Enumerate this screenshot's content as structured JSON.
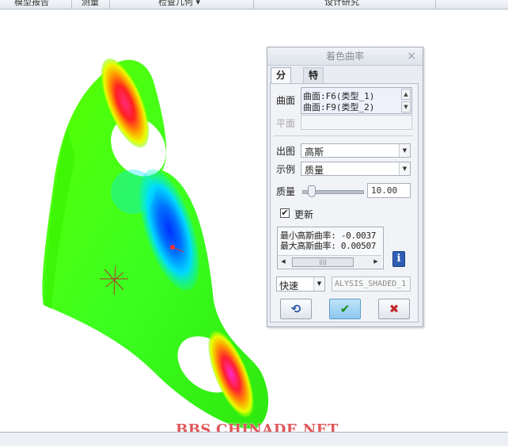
{
  "ribbon": {
    "groups": [
      "模型报告",
      "测量",
      "检查几何 ▾",
      "设计研究"
    ]
  },
  "dialog": {
    "title": "着色曲率",
    "close_glyph": "×",
    "tabs": [
      "分析",
      "特征"
    ],
    "surface_label": "曲面",
    "surfaces": [
      "曲面:F6(类型_1)",
      "曲面:F9(类型_2)"
    ],
    "plane_label": "平面",
    "output_label": "出图",
    "output_value": "高斯",
    "example_label": "示例",
    "example_value": "质量",
    "quality_label": "质量",
    "quality_value": "10.00",
    "quality_slider_fraction": 0.1,
    "update_label": "更新",
    "update_checked": true,
    "check_glyph": "✔",
    "result_lines": [
      "最小高斯曲率: -0.0037",
      "最大高斯曲率: 0.00507"
    ],
    "scroll_thumb_glyph": "||||",
    "info_glyph": "i",
    "speed_value": "快速",
    "name_value": "ALYSIS_SHADED_1",
    "buttons": {
      "repaint_glyph": "⟲",
      "ok_glyph": "✔",
      "cancel_glyph": "✖"
    }
  },
  "watermark": "BBS.CHINADE.NET",
  "icons": {
    "close": "close-icon",
    "up": "up-arrow-icon",
    "down": "down-arrow-icon",
    "dropdown": "chevron-down-icon",
    "info": "info-icon",
    "repaint": "repaint-icon",
    "ok": "check-icon",
    "cancel": "cross-icon",
    "csys": "coordinate-system-icon"
  }
}
